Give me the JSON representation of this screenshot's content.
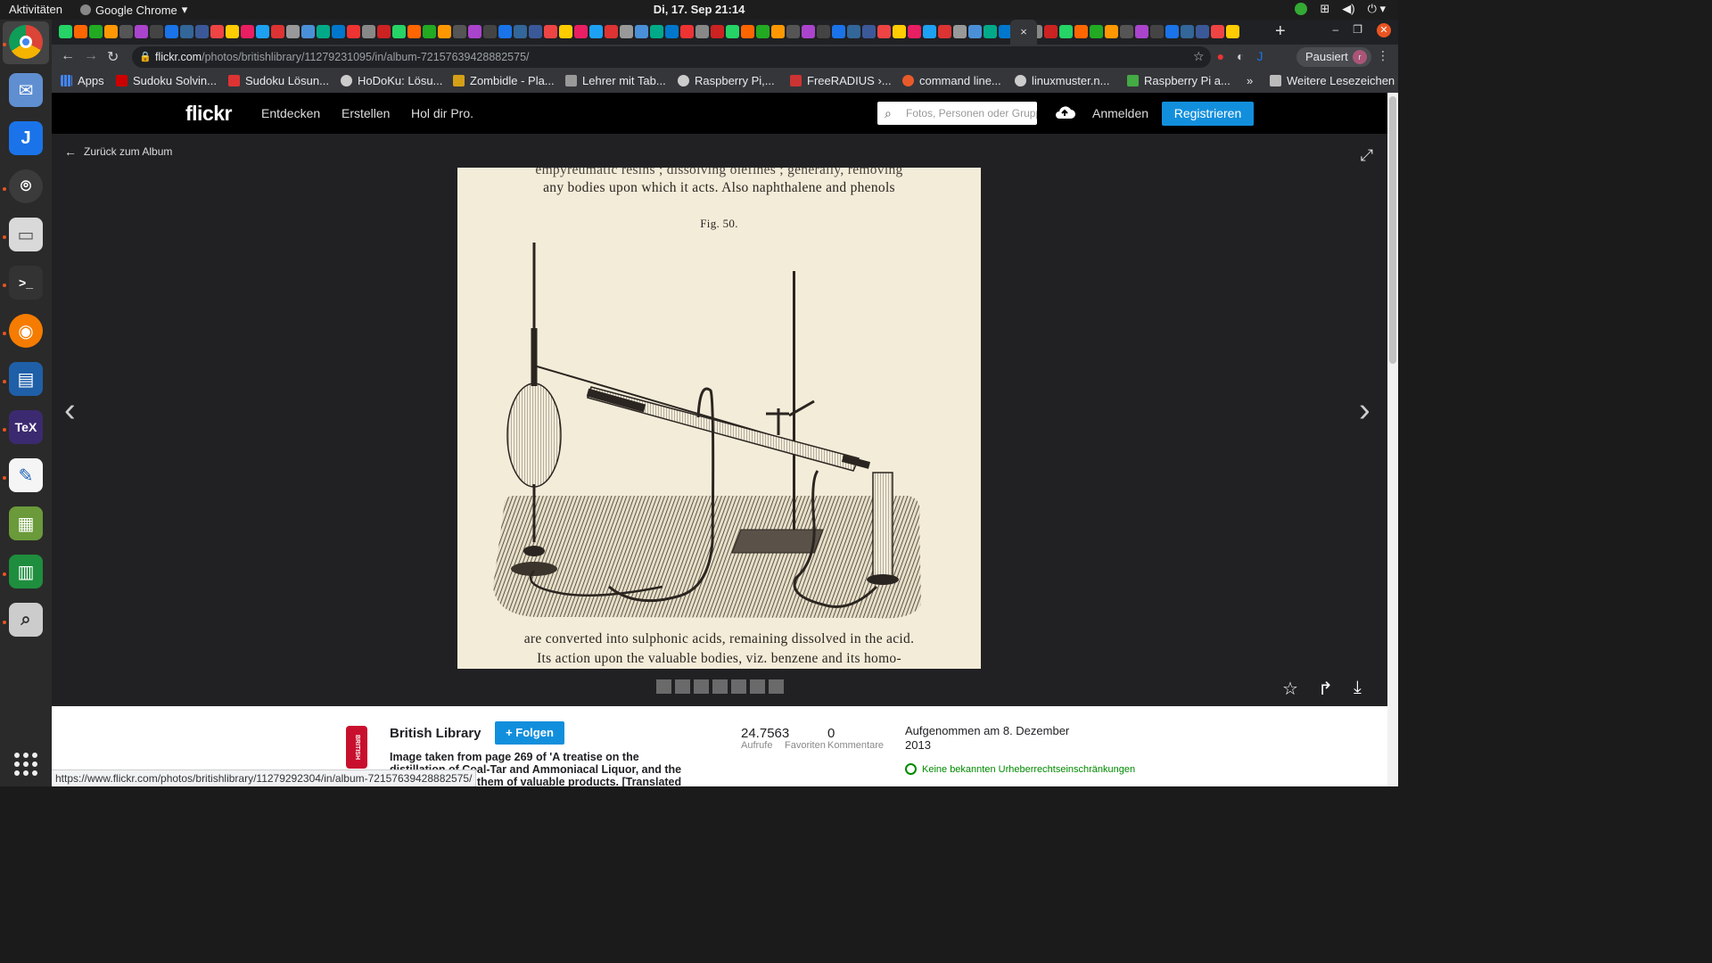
{
  "system": {
    "activities": "Aktivitäten",
    "app_name": "Google Chrome",
    "clock": "Di, 17. Sep  21:14"
  },
  "chrome": {
    "active_tab_close": "×",
    "url_host": "flickr.com",
    "url_path": "/photos/britishlibrary/11279231095/in/album-72157639428882575/",
    "profile_label": "Pausiert",
    "profile_initial": "r",
    "bookmarks": [
      "Apps",
      "Sudoku Solvin...",
      "Sudoku Lösun...",
      "HoDoKu: Lösu...",
      "Zombidle - Pla...",
      "Lehrer mit Tab...",
      "Raspberry Pi,...",
      "FreeRADIUS ›...",
      "command line...",
      "linuxmuster.n...",
      "Raspberry Pi a...",
      "»",
      "Weitere Lesezeichen"
    ],
    "status_url": "https://www.flickr.com/photos/britishlibrary/11279292304/in/album-72157639428882575/"
  },
  "flickr": {
    "logo": "flickr",
    "nav": [
      "Entdecken",
      "Erstellen",
      "Hol dir Pro."
    ],
    "search_placeholder": "Fotos, Personen oder Gruppen",
    "login": "Anmelden",
    "register": "Registrieren",
    "back": "Zurück zum Album",
    "photo": {
      "line_top_1": "empyreumatic resins ; dissolving olefines ; generally, removing",
      "line_top_2": "any bodies upon which it acts.  Also naphthalene and phenols",
      "fig_caption": "Fig. 50.",
      "line_bottom_1": "are converted into sulphonic acids, remaining dissolved in the acid.",
      "line_bottom_2": "Its action upon the valuable bodies, viz. benzene and its homo-"
    },
    "owner": "British Library",
    "owner_logo_text": "BRITISH LIBRARY",
    "follow": "+ Folgen",
    "description": "Image taken from page 269 of 'A treatise on the distillation of Coal-Tar and Ammoniacal Liquor, and the separation from them of valuable products. [Translated",
    "stats": {
      "views_value": "24.7563",
      "views_label": "Aufrufe",
      "faves_value": "0",
      "faves_label": "Favoriten",
      "comments_label": "Kommentare"
    },
    "taken": "Aufgenommen am 8. Dezember 2013",
    "rights": "Keine bekannten Urheberrechtseinschränkungen"
  },
  "colors": {
    "flickr_blue": "#128fdc",
    "rights_green": "#008a00",
    "bl_red": "#c8102e",
    "paper": "#f3ecd9"
  }
}
